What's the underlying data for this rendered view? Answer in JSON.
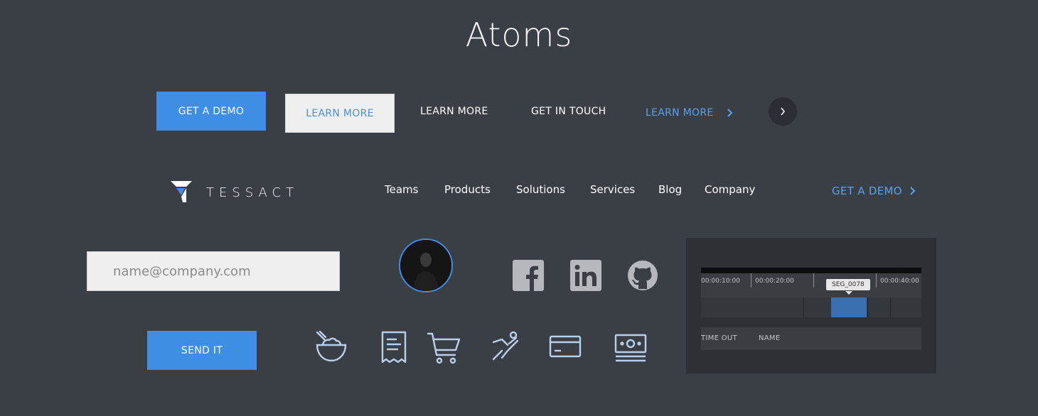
{
  "title": "Atoms",
  "buttons": {
    "get_demo": "GET A DEMO",
    "learn_more_light": "LEARN MORE",
    "learn_more_text": "LEARN MORE",
    "get_in_touch": "GET IN TOUCH",
    "learn_more_link": "LEARN MORE"
  },
  "nav": {
    "brand": "TESSACT",
    "items": [
      "Teams",
      "Products",
      "Solutions",
      "Services",
      "Blog",
      "Company"
    ],
    "cta": "GET A DEMO"
  },
  "form": {
    "email_placeholder": "name@company.com",
    "send_label": "SEND IT"
  },
  "icons": {
    "social": [
      "facebook-icon",
      "linkedin-icon",
      "github-icon"
    ],
    "row": [
      "bowl-icon",
      "receipt-icon",
      "cart-icon",
      "sports-icon",
      "credit-card-icon",
      "money-icon"
    ]
  },
  "timeline": {
    "ticks": [
      "00:00:10:00",
      "00:00:20:00",
      "00:00:40:00"
    ],
    "segment_label": "SEG_0078",
    "columns": [
      "TIME OUT",
      "NAME"
    ]
  },
  "colors": {
    "background": "#3a3e45",
    "primary": "#3e8ee6",
    "link": "#5aa2ee",
    "light_button": "#efefef"
  }
}
